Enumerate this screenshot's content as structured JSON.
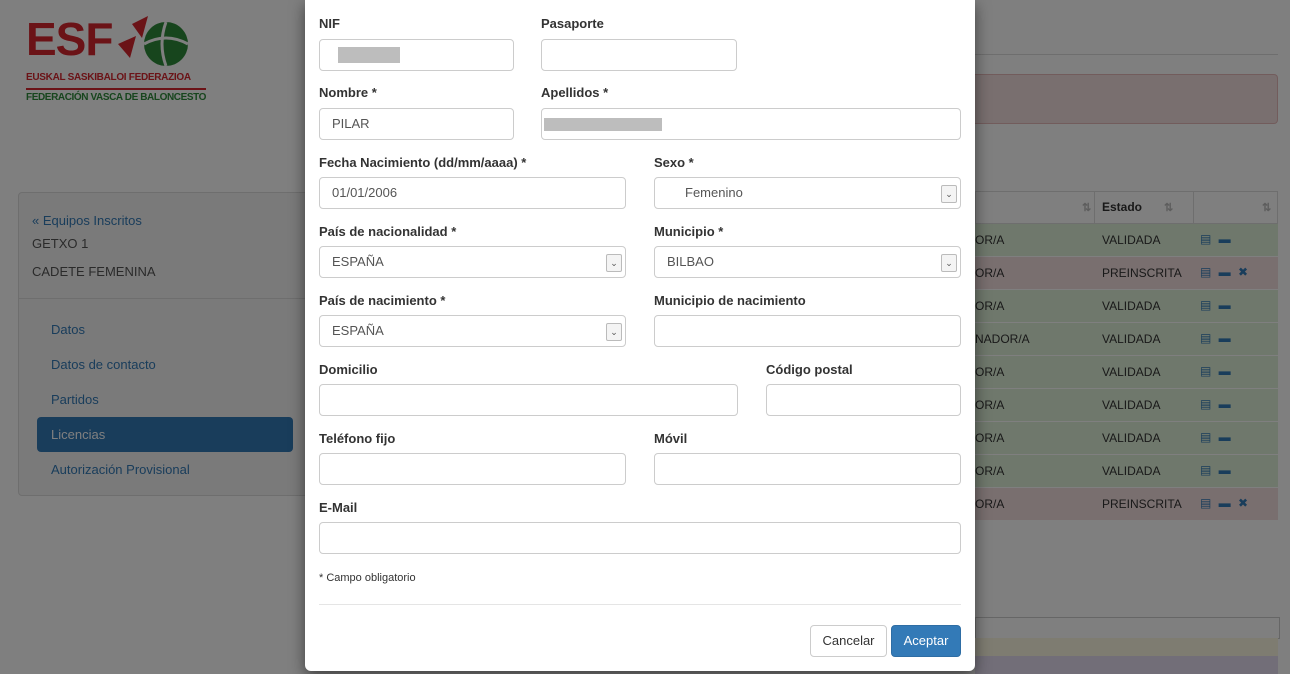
{
  "background": {
    "logo": {
      "abbr": "ESF",
      "line1": "EUSKAL SASKIBALOI FEDERAZIOA",
      "line2": "FEDERACIÓN VASCA DE BALONCESTO"
    },
    "sidebar": {
      "back_link": "« Equipos Inscritos",
      "team_name": "GETXO 1",
      "category": "CADETE FEMENINA",
      "items": [
        {
          "label": "Datos",
          "active": false
        },
        {
          "label": "Datos de contacto",
          "active": false
        },
        {
          "label": "Partidos",
          "active": false
        },
        {
          "label": "Licencias",
          "active": true
        },
        {
          "label": "Autorización Provisional",
          "active": false
        }
      ]
    },
    "table": {
      "header_estado": "Estado",
      "sort_glyph": "⇅",
      "rows": [
        {
          "role": "OR/A",
          "state": "VALIDADA",
          "status": "ok",
          "icons": "▤ ▬"
        },
        {
          "role": "OR/A",
          "state": "PREINSCRITA",
          "status": "pre",
          "icons": "▤ ▬ ✖"
        },
        {
          "role": "OR/A",
          "state": "VALIDADA",
          "status": "ok",
          "icons": "▤ ▬"
        },
        {
          "role": "NADOR/A",
          "state": "VALIDADA",
          "status": "ok",
          "icons": "▤ ▬"
        },
        {
          "role": "OR/A",
          "state": "VALIDADA",
          "status": "ok",
          "icons": "▤ ▬"
        },
        {
          "role": "OR/A",
          "state": "VALIDADA",
          "status": "ok",
          "icons": "▤ ▬"
        },
        {
          "role": "OR/A",
          "state": "VALIDADA",
          "status": "ok",
          "icons": "▤ ▬"
        },
        {
          "role": "OR/A",
          "state": "VALIDADA",
          "status": "ok",
          "icons": "▤ ▬"
        },
        {
          "role": "OR/A",
          "state": "PREINSCRITA",
          "status": "pre",
          "icons": "▤ ▬ ✖"
        }
      ]
    }
  },
  "form": {
    "nif": {
      "label": "NIF",
      "value": ""
    },
    "pasaporte": {
      "label": "Pasaporte",
      "value": ""
    },
    "nombre": {
      "label": "Nombre *",
      "value": "PILAR"
    },
    "apellidos": {
      "label": "Apellidos *",
      "value": ""
    },
    "fecha_nacimiento": {
      "label": "Fecha Nacimiento (dd/mm/aaaa) *",
      "value": "01/01/2006"
    },
    "sexo": {
      "label": "Sexo *",
      "value": "Femenino"
    },
    "pais_nacionalidad": {
      "label": "País de nacionalidad *",
      "value": "ESPAÑA"
    },
    "municipio": {
      "label": "Municipio *",
      "value": "BILBAO"
    },
    "pais_nacimiento": {
      "label": "País de nacimiento *",
      "value": "ESPAÑA"
    },
    "municipio_nacimiento": {
      "label": "Municipio de nacimiento",
      "value": ""
    },
    "domicilio": {
      "label": "Domicilio",
      "value": ""
    },
    "codigo_postal": {
      "label": "Código postal",
      "value": ""
    },
    "telefono_fijo": {
      "label": "Teléfono fijo",
      "value": ""
    },
    "movil": {
      "label": "Móvil",
      "value": ""
    },
    "email": {
      "label": "E-Mail",
      "value": ""
    },
    "required_note": "* Campo obligatorio",
    "cancel_label": "Cancelar",
    "accept_label": "Aceptar",
    "select_arrow_glyph": "⌄"
  },
  "colors": {
    "primary": "#337ab7",
    "brand_red": "#d6262f",
    "brand_green": "#2e8a3a",
    "row_ok": "#dff0d8",
    "row_pre": "#f2dede"
  }
}
